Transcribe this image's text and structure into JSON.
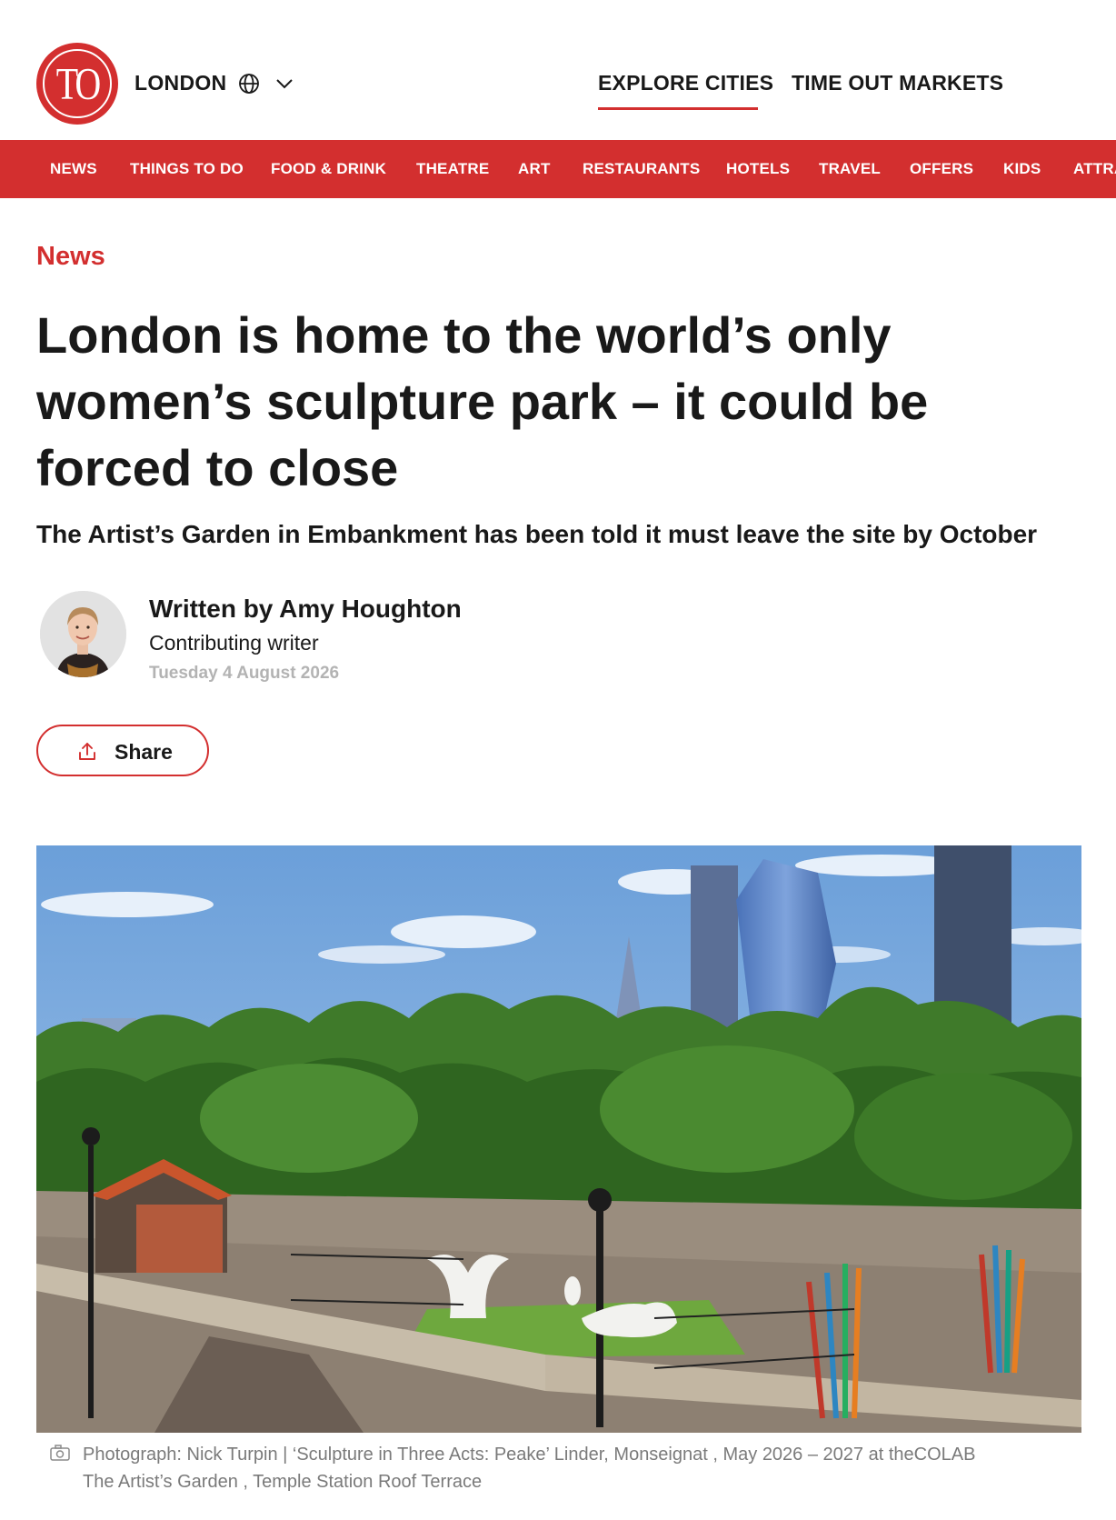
{
  "header": {
    "logo_text": "TO",
    "city": "LONDON",
    "nav": [
      {
        "label": "EXPLORE CITIES"
      },
      {
        "label": "TIME OUT MARKETS"
      }
    ]
  },
  "menu": [
    "NEWS",
    "THINGS TO DO",
    "FOOD & DRINK",
    "THEATRE",
    "ART",
    "RESTAURANTS",
    "HOTELS",
    "TRAVEL",
    "OFFERS",
    "KIDS",
    "ATTRACTIONS"
  ],
  "article": {
    "section": "News",
    "headline": "London is home to the world’s only women’s sculpture park – it could be forced to close",
    "standfirst": "The Artist’s Garden in Embankment has been told it must leave the site by October",
    "byline": "Written by Amy Houghton",
    "role": "Contributing writer",
    "date": "Tuesday 4 August 2026",
    "share_label": "Share",
    "caption_line1": "Photograph: Nick Turpin  |  ‘Sculpture in Three Acts: Peake’ Linder, Monseignat , May 2026 – 2027 at theCOLAB",
    "caption_line2": "The Artist’s Garden , Temple Station Roof Terrace"
  },
  "colors": {
    "brand_red": "#d32f2f",
    "text": "#191919",
    "muted": "#b3b3b3"
  },
  "icons": [
    "globe-icon",
    "chevron-down-icon",
    "share-icon",
    "camera-icon"
  ]
}
